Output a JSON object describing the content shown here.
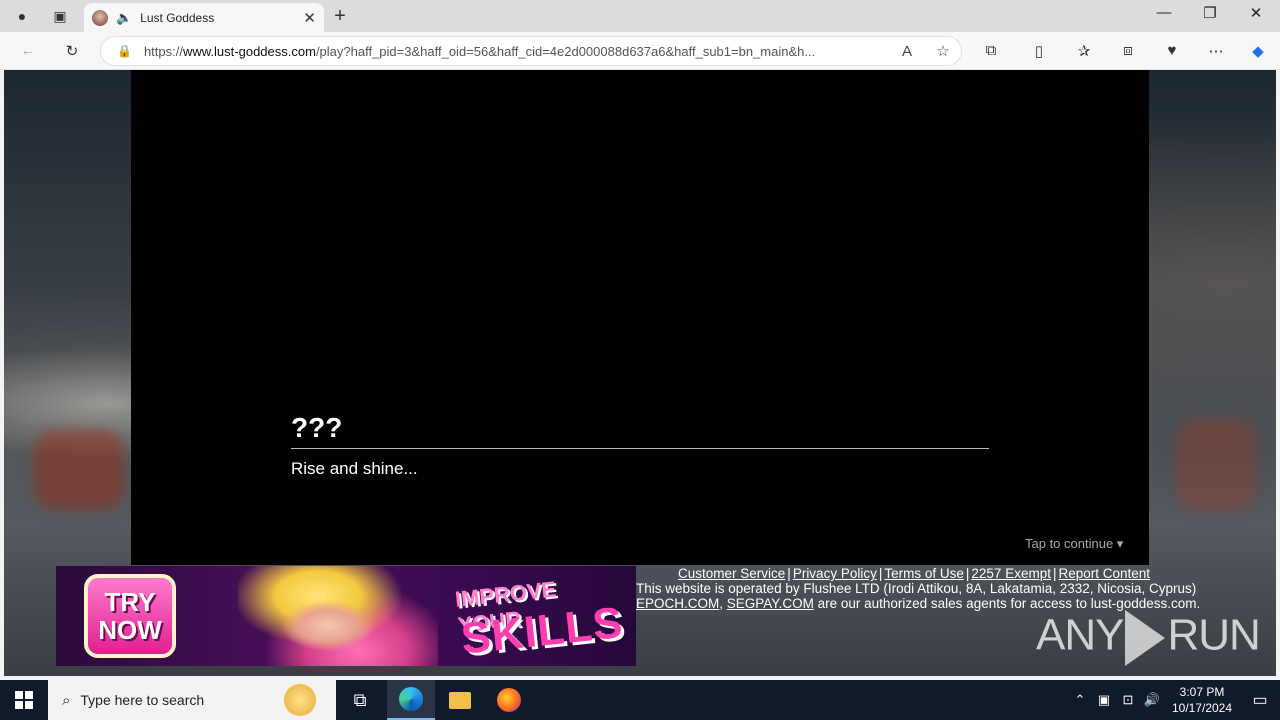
{
  "browser": {
    "tab_title": "Lust Goddess",
    "url_prefix": "https://",
    "url_domain": "www.lust-goddess.com",
    "url_path": "/play?haff_pid=3&haff_oid=56&haff_cid=4e2d000088d637a6&haff_sub1=bn_main&h..."
  },
  "game": {
    "speaker": "???",
    "dialogue": "Rise and shine...",
    "tap_hint": "Tap to continue ▾"
  },
  "banner": {
    "try_line1": "TRY",
    "try_line2": "NOW",
    "improve": "IMPROVE YOUR",
    "skills": "SKILLS"
  },
  "footer": {
    "links": [
      "Customer Service",
      "Privacy Policy",
      "Terms of Use",
      "2257 Exempt",
      "Report Content"
    ],
    "separator": "|",
    "operator_text": "This website is operated by Flushee LTD (Irodi Attikou, 8A, Lakatamia, 2332, Nicosia, Cyprus)",
    "agent1": "EPOCH.COM",
    "comma": ",",
    "agent2": "SEGPAY.COM",
    "agents_text": "are our authorized sales agents for access to lust-goddess.com."
  },
  "watermark": {
    "left": "ANY",
    "right": "RUN"
  },
  "taskbar": {
    "search_placeholder": "Type here to search",
    "time": "3:07 PM",
    "date": "10/17/2024"
  }
}
